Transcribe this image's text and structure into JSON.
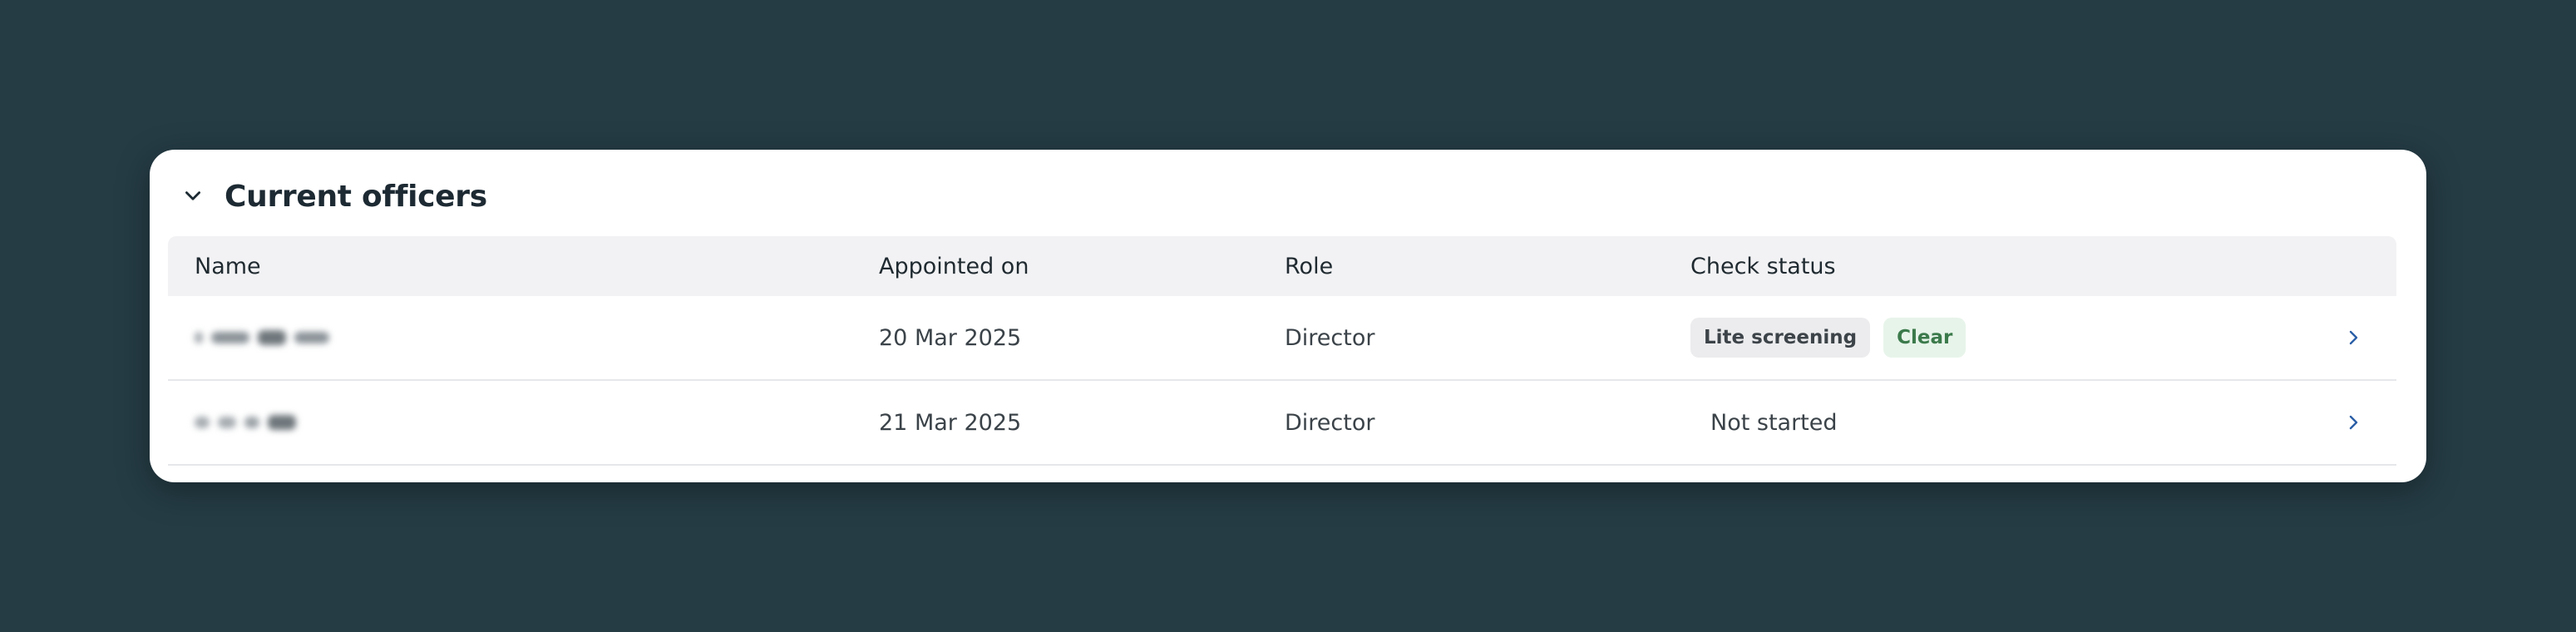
{
  "section": {
    "title": "Current officers",
    "collapse_icon": "chevron-down-icon"
  },
  "table": {
    "headers": {
      "name": "Name",
      "appointed_on": "Appointed on",
      "role": "Role",
      "check_status": "Check status"
    },
    "rows": [
      {
        "name": "[redacted]",
        "appointed_on": "20 Mar 2025",
        "role": "Director",
        "badges": [
          "Lite screening",
          "Clear"
        ],
        "status_text": "",
        "action_icon": "chevron-right-icon"
      },
      {
        "name": "[redacted]",
        "appointed_on": "21 Mar 2025",
        "role": "Director",
        "badges": [],
        "status_text": "Not started",
        "action_icon": "chevron-right-icon"
      }
    ]
  },
  "colors": {
    "background": "#253c45",
    "link_accent": "#2b5fa6",
    "success_badge_bg": "#e7f4ea",
    "success_badge_text": "#3b7a4b",
    "neutral_badge_bg": "#ececee"
  }
}
